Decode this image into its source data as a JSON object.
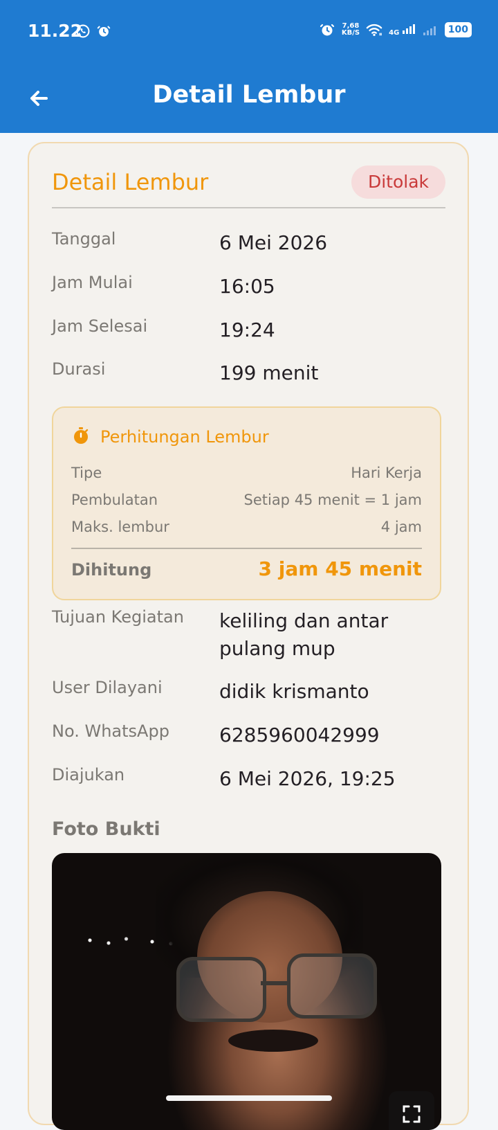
{
  "status_bar": {
    "time": "11.22",
    "left_icons": [
      "whatsapp-icon",
      "alarm-clock-icon"
    ],
    "right_icons": [
      "alarm-clock-icon",
      "network-speed-indicator",
      "wifi-icon",
      "4g-signal-icon",
      "signal-bars-icon",
      "battery-icon"
    ],
    "network_speed_top": "7,68",
    "network_speed_bottom": "KB/S",
    "network_type": "4G",
    "battery": "100"
  },
  "header": {
    "title": "Detail Lembur"
  },
  "card": {
    "title": "Detail Lembur",
    "status": "Ditolak",
    "details": [
      {
        "label": "Tanggal",
        "value": "6 Mei 2026"
      },
      {
        "label": "Jam Mulai",
        "value": "16:05"
      },
      {
        "label": "Jam Selesai",
        "value": "19:24"
      },
      {
        "label": "Durasi",
        "value": "199 menit"
      }
    ],
    "calculation": {
      "title": "Perhitungan Lembur",
      "rows": [
        {
          "label": "Tipe",
          "value": "Hari Kerja"
        },
        {
          "label": "Pembulatan",
          "value": "Setiap 45 menit = 1 jam"
        },
        {
          "label": "Maks. lembur",
          "value": "4 jam"
        }
      ],
      "total_label": "Dihitung",
      "total_value": "3 jam 45 menit"
    },
    "more_details": [
      {
        "label": "Tujuan Kegiatan",
        "value": "keliling dan antar pulang mup"
      },
      {
        "label": "User Dilayani",
        "value": "didik krismanto"
      },
      {
        "label": "No. WhatsApp",
        "value": "6285960042999"
      },
      {
        "label": "Diajukan",
        "value": "6 Mei 2026, 19:25"
      }
    ],
    "photo_title": "Foto Bukti"
  },
  "colors": {
    "primary": "#1f7bd1",
    "accent": "#f0960b",
    "status_danger_bg": "#f6dcdc",
    "status_danger_text": "#c93a3a"
  }
}
